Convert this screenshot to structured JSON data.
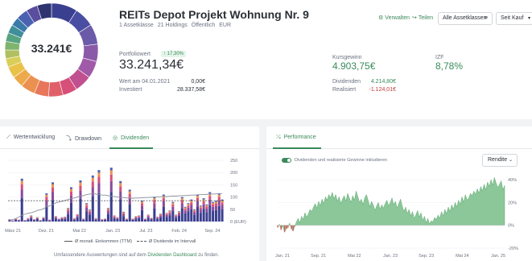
{
  "portfolio": {
    "total": "33.241€",
    "title": "REITs Depot Projekt Wohnung Nr. 9",
    "meta": [
      "1 Assetklasse",
      "21 Holdings",
      "Öffentlich",
      "EUR"
    ],
    "allocation": [
      {
        "color": "#3b3f8f",
        "share": 9
      },
      {
        "color": "#4a4ea3",
        "share": 7
      },
      {
        "color": "#6a5aa8",
        "share": 7
      },
      {
        "color": "#8a5aa8",
        "share": 6
      },
      {
        "color": "#a05aa8",
        "share": 6
      },
      {
        "color": "#c0508f",
        "share": 6
      },
      {
        "color": "#d6507a",
        "share": 5
      },
      {
        "color": "#e0606a",
        "share": 5
      },
      {
        "color": "#e8765a",
        "share": 5
      },
      {
        "color": "#eb9050",
        "share": 5
      },
      {
        "color": "#edaa4c",
        "share": 4
      },
      {
        "color": "#e9c24a",
        "share": 4
      },
      {
        "color": "#d9cf58",
        "share": 3
      },
      {
        "color": "#b0c060",
        "share": 3
      },
      {
        "color": "#7fb46e",
        "share": 3
      },
      {
        "color": "#56a382",
        "share": 3
      },
      {
        "color": "#3f8f9a",
        "share": 3
      },
      {
        "color": "#3a7aa8",
        "share": 3
      },
      {
        "color": "#4a62b0",
        "share": 4
      },
      {
        "color": "#5a4e9e",
        "share": 4
      },
      {
        "color": "#2e3470",
        "share": 5
      }
    ]
  },
  "actions": {
    "verwalten": "Verwalten",
    "teilen": "Teilen",
    "assetclass": "Alle Assetklassen",
    "period": "Seit Kauf"
  },
  "stats": {
    "portfoliowert_label": "Portfoliowert",
    "portfoliowert_change": "17,30%",
    "portfoliowert": "33.241,34€",
    "wert_am_label": "Wert am 04.01.2021",
    "wert_am": "0,00€",
    "investiert_label": "Investiert",
    "investiert": "28.337,58€",
    "kursgewinn_label": "Kursgewinn",
    "kursgewinn": "4.903,75€",
    "izf_label": "IZF",
    "izf": "8,78%",
    "dividenden_label": "Dividenden",
    "dividenden": "4.214,80€",
    "realisiert_label": "Realisiert",
    "realisiert": "-1.124,01€"
  },
  "left_panel": {
    "tabs": [
      "Wertentwicklung",
      "Drawdown",
      "Dividenden"
    ],
    "active_tab": "Dividenden",
    "legend_avg": "Ø monatl. Einkommen (TTM)",
    "legend_interval": "Ø Dividende im Intervall",
    "footnote_pre": "Umfassendere Auswertungen sind auf dem",
    "footnote_link": "Dividenden Dashboard",
    "footnote_post": "zu finden."
  },
  "right_panel": {
    "tab": "Performance",
    "toggle_label": "Dividenden und realisierte Gewinne inkludieren",
    "select": "Rendite"
  },
  "chart_data": [
    {
      "type": "bar",
      "title": "",
      "stacked": true,
      "x_tick_labels": [
        "März 21",
        "Dez. 21",
        "Mai 22",
        "Jan. 23",
        "Jul. 23",
        "Feb. 24",
        "Sep. 24"
      ],
      "y_tick_labels": [
        "250",
        "200",
        "150",
        "100",
        "50",
        "0 (EUR)"
      ],
      "ylim": [
        0,
        250
      ],
      "grid": true,
      "legend_position": "bottom",
      "monthly_totals": [
        10,
        5,
        12,
        8,
        175,
        6,
        14,
        25,
        10,
        18,
        6,
        18,
        115,
        8,
        160,
        22,
        12,
        18,
        20,
        55,
        140,
        14,
        30,
        168,
        12,
        75,
        48,
        188,
        14,
        210,
        10,
        12,
        55,
        220,
        25,
        18,
        165,
        40,
        12,
        130,
        12,
        22,
        25,
        85,
        12,
        28,
        15,
        100,
        20,
        32,
        110,
        35,
        45,
        80,
        28,
        42,
        100,
        60,
        75,
        90,
        50,
        110,
        65,
        95,
        70,
        120,
        80,
        85,
        115,
        90
      ],
      "series": [
        {
          "name": "Ø monatl. Einkommen (TTM)",
          "style": "line",
          "values": [
            5,
            8,
            12,
            18,
            26,
            30,
            34,
            36,
            40,
            45,
            48,
            52,
            60,
            64,
            70,
            76,
            80,
            82,
            86,
            90,
            94,
            96,
            100,
            104,
            106,
            110,
            112,
            114,
            112,
            110,
            108,
            108,
            106,
            104,
            102,
            100,
            98,
            98,
            96,
            96,
            95,
            96,
            96,
            97,
            98,
            98,
            99,
            100,
            100,
            101,
            102,
            102,
            103,
            104,
            104,
            105,
            106,
            106,
            107,
            108,
            108,
            109,
            110,
            110,
            111,
            112,
            112,
            113,
            114,
            114
          ]
        },
        {
          "name": "Ø Dividende im Intervall",
          "style": "dashed",
          "values": [
            85
          ]
        }
      ]
    },
    {
      "type": "area",
      "title": "",
      "x_tick_labels": [
        "Jan. 21",
        "Sep. 21",
        "Mai 22",
        "Jan. 23",
        "Sep. 23",
        "Mai 24",
        "Jan. 25"
      ],
      "y_tick_labels": [
        "40%",
        "20%",
        "0%",
        "-20%"
      ],
      "ylim": [
        -20,
        45
      ],
      "grid": true,
      "series": [
        {
          "name": "",
          "values": [
            -2,
            1,
            -4,
            0,
            -6,
            -3,
            -2,
            2,
            -3,
            -5,
            -1,
            3,
            6,
            2,
            8,
            5,
            11,
            7,
            10,
            14,
            12,
            16,
            19,
            15,
            21,
            17,
            23,
            19,
            25,
            22,
            27,
            24,
            29,
            23,
            27,
            21,
            25,
            19,
            23,
            26,
            21,
            28,
            24,
            20,
            26,
            22,
            30,
            25,
            20,
            23,
            18,
            24,
            27,
            22,
            16,
            21,
            18,
            13,
            17,
            20,
            14,
            18,
            15,
            19,
            22,
            17,
            20,
            24,
            18,
            21,
            15,
            19,
            23,
            17,
            12,
            16,
            10,
            14,
            8,
            12,
            6,
            9,
            13,
            7,
            11,
            4,
            8,
            2,
            6,
            1,
            4,
            3,
            7,
            5,
            9,
            6,
            12,
            8,
            14,
            10,
            16,
            12,
            18,
            14,
            20,
            16,
            22,
            18,
            25,
            20,
            27,
            22,
            24,
            28,
            26,
            30,
            27,
            32,
            28,
            34,
            30,
            36,
            31,
            38,
            34,
            40,
            35,
            42,
            37,
            33,
            36,
            39,
            31,
            35
          ]
        }
      ]
    }
  ]
}
